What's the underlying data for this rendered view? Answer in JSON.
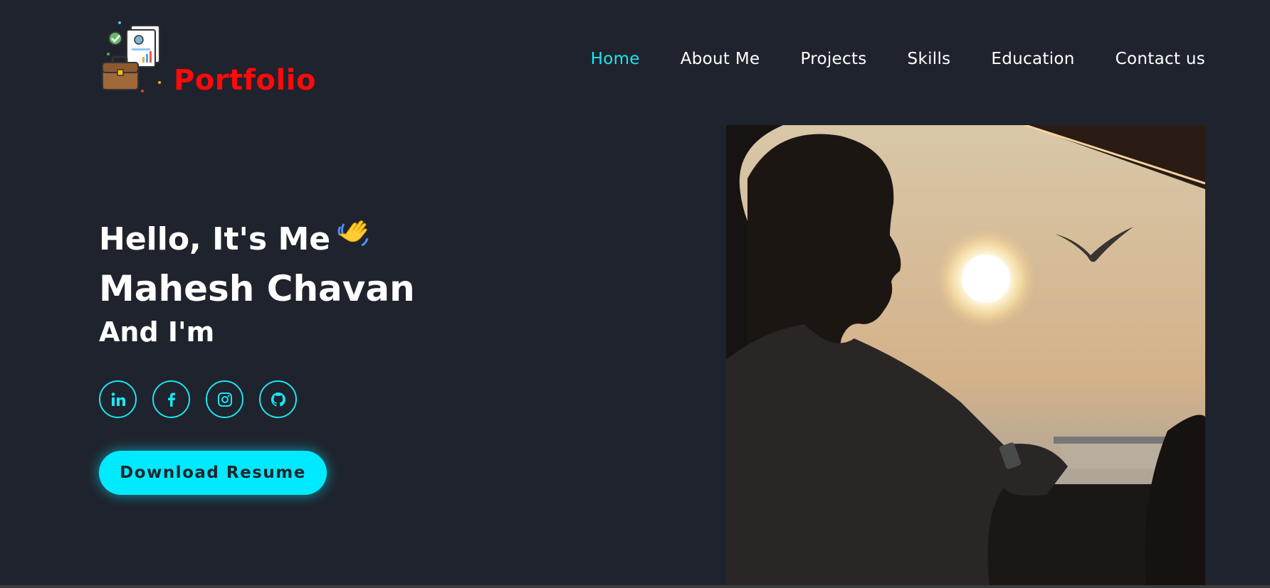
{
  "header": {
    "logo_text": "Portfolio",
    "logo_icon": "portfolio-briefcase-icon",
    "brand_color": "#ff0a0a"
  },
  "nav": {
    "items": [
      {
        "label": "Home",
        "active": true
      },
      {
        "label": "About Me"
      },
      {
        "label": "Projects"
      },
      {
        "label": "Skills"
      },
      {
        "label": "Education"
      },
      {
        "label": "Contact us"
      }
    ],
    "active_color": "#19e6f2"
  },
  "hero": {
    "greeting": "Hello, It's Me",
    "wave_icon": "waving-hand-icon",
    "name": "Mahesh Chavan",
    "subtitle": "And I'm",
    "socials": [
      {
        "icon": "linkedin-icon"
      },
      {
        "icon": "facebook-icon"
      },
      {
        "icon": "instagram-icon"
      },
      {
        "icon": "github-icon"
      }
    ],
    "resume_label": "Download Resume",
    "accent_color": "#00eaff"
  },
  "colors": {
    "background": "#1f232d"
  }
}
